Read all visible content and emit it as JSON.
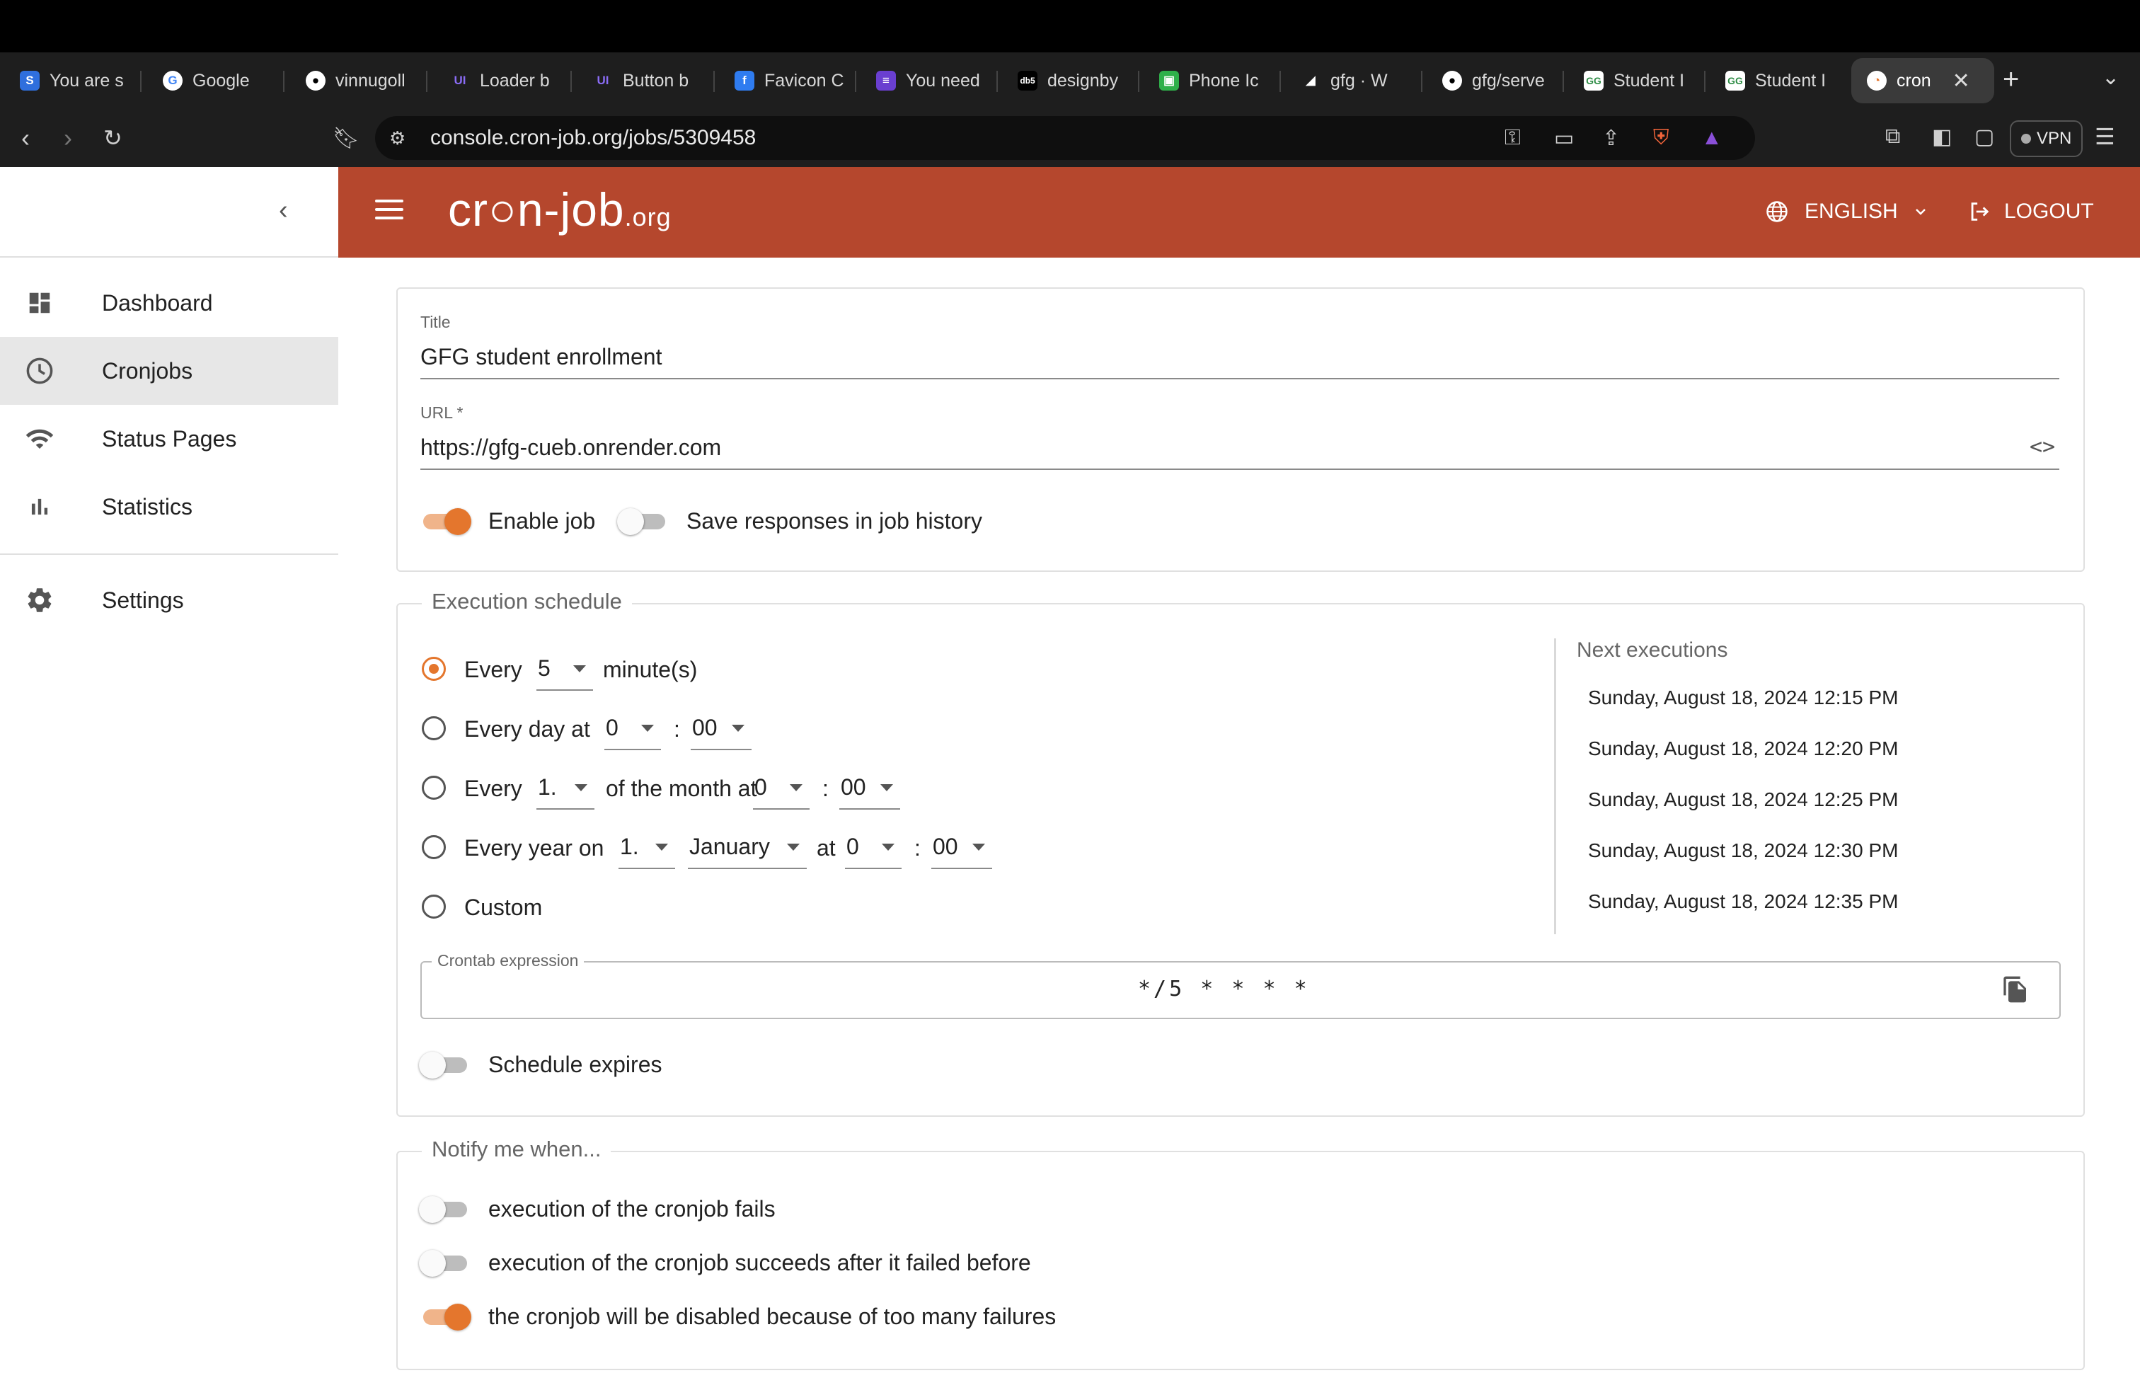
{
  "browser": {
    "tabs": [
      {
        "label": "You are s",
        "icon": "s-favicon",
        "color": "#2f6fdd"
      },
      {
        "label": "Google",
        "icon": "google-favicon",
        "color": "#ffffff"
      },
      {
        "label": "vinnugoll",
        "icon": "github-favicon",
        "color": "#ffffff"
      },
      {
        "label": "Loader b",
        "icon": "uiverse-favicon",
        "color": "#6c4cf0"
      },
      {
        "label": "Button b",
        "icon": "uiverse-favicon",
        "color": "#6c4cf0"
      },
      {
        "label": "Favicon C",
        "icon": "favicon-favicon",
        "color": "#2f7cf0"
      },
      {
        "label": "You need",
        "icon": "list-favicon",
        "color": "#6a3fd0"
      },
      {
        "label": "designby",
        "icon": "db5-favicon",
        "color": "#000000"
      },
      {
        "label": "Phone Ic",
        "icon": "phone-favicon",
        "color": "#2fb04a"
      },
      {
        "label": "gfg · W",
        "icon": "render-favicon",
        "color": "#ffffff"
      },
      {
        "label": "gfg/serve",
        "icon": "github-favicon",
        "color": "#ffffff"
      },
      {
        "label": "Student I",
        "icon": "gfg-favicon",
        "color": "#2f8d46"
      },
      {
        "label": "Student I",
        "icon": "gfg-favicon",
        "color": "#2f8d46"
      },
      {
        "label": "cron",
        "icon": "cron-favicon",
        "color": "#e4762d",
        "active": true
      }
    ],
    "url": "console.cron-job.org/jobs/5309458",
    "vpn_label": "VPN"
  },
  "sidebar": {
    "items": [
      {
        "label": "Dashboard",
        "icon": "dashboard-icon"
      },
      {
        "label": "Cronjobs",
        "icon": "clock-icon",
        "active": true
      },
      {
        "label": "Status Pages",
        "icon": "wifi-icon"
      },
      {
        "label": "Statistics",
        "icon": "bar-chart-icon"
      },
      {
        "label": "Settings",
        "icon": "gear-icon"
      }
    ]
  },
  "header": {
    "logo_main": "cr○n-job",
    "logo_suffix": ".org",
    "language": "ENGLISH",
    "logout": "LOGOUT",
    "color": "#b5472d"
  },
  "job": {
    "title_label": "Title",
    "title_value": "GFG student enrollment",
    "url_label": "URL *",
    "url_value": "https://gfg-cueb.onrender.com",
    "enable_job_label": "Enable job",
    "enable_job": true,
    "save_responses_label": "Save responses in job history",
    "save_responses": false
  },
  "schedule": {
    "legend": "Execution schedule",
    "selected": "every_minutes",
    "every_label": "Every",
    "every_minutes_value": "5",
    "minutes_label": "minute(s)",
    "every_day_label": "Every day at",
    "day_hour": "0",
    "day_minute": "00",
    "colon": ":",
    "every_month_label": "Every",
    "month_day": "1.",
    "of_month_label": "of the month at",
    "month_hour": "0",
    "month_minute": "00",
    "every_year_label": "Every year on",
    "year_day": "1.",
    "year_month": "January",
    "at_label": "at",
    "year_hour": "0",
    "year_minute": "00",
    "custom_label": "Custom",
    "next_heading": "Next executions",
    "next_executions": [
      "Sunday, August 18, 2024 12:15 PM",
      "Sunday, August 18, 2024 12:20 PM",
      "Sunday, August 18, 2024 12:25 PM",
      "Sunday, August 18, 2024 12:30 PM",
      "Sunday, August 18, 2024 12:35 PM"
    ],
    "crontab_label": "Crontab expression",
    "crontab_value": "*/5 * * * *",
    "expires_label": "Schedule expires",
    "expires": false
  },
  "notify": {
    "legend": "Notify me when...",
    "items": [
      {
        "label": "execution of the cronjob fails",
        "on": false
      },
      {
        "label": "execution of the cronjob succeeds after it failed before",
        "on": false
      },
      {
        "label": "the cronjob will be disabled because of too many failures",
        "on": true
      }
    ]
  },
  "accent_color": "#e4762d"
}
